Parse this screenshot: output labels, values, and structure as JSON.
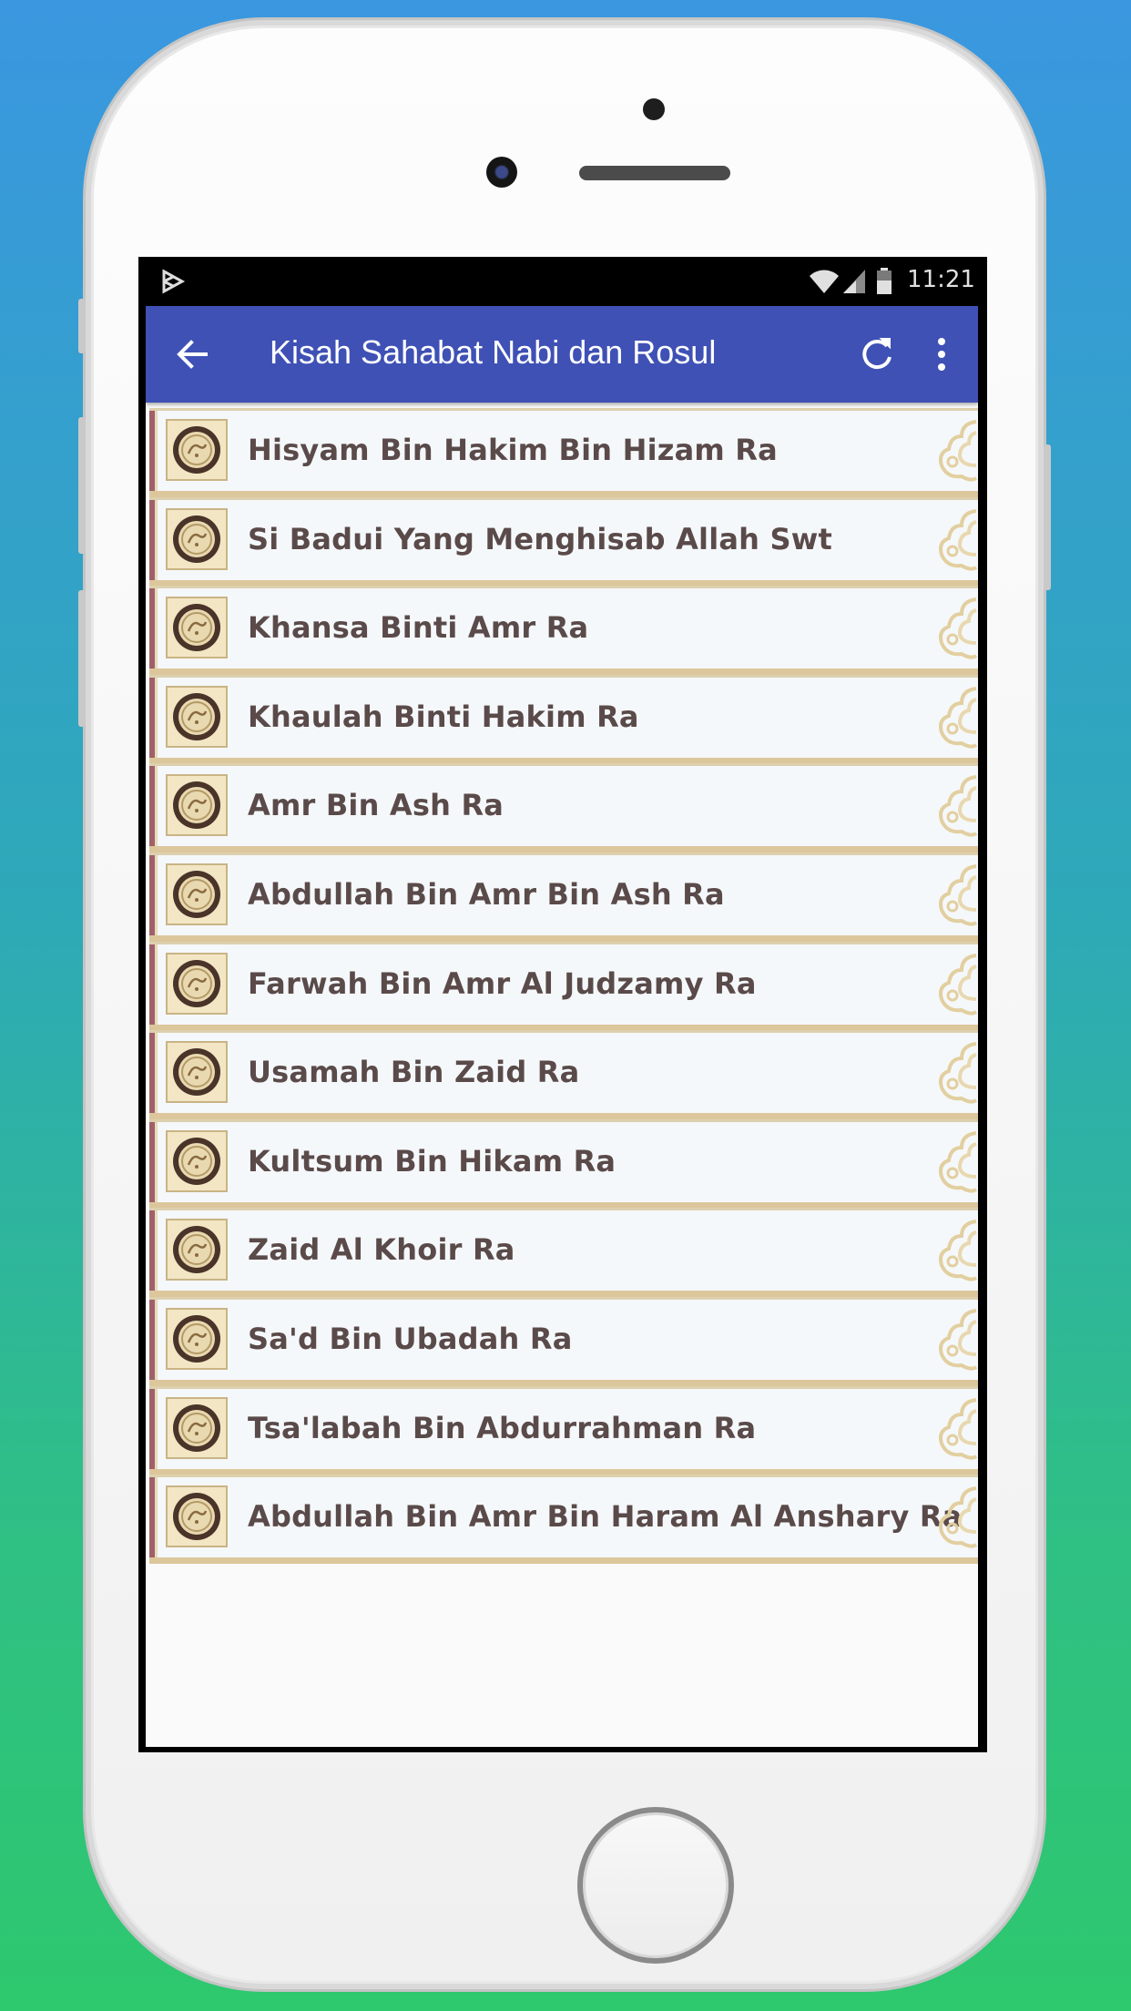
{
  "statusbar": {
    "time": "11:21",
    "icons": [
      "play-store-notification-icon",
      "wifi-icon",
      "signal-icon",
      "battery-icon"
    ]
  },
  "toolbar": {
    "title": "Kisah Sahabat Nabi dan Rosul",
    "back_icon": "arrow-back-icon",
    "refresh_icon": "refresh-icon",
    "more_icon": "more-vertical-icon",
    "color": "#3f51b5"
  },
  "list": {
    "items": [
      {
        "label": "Hisyam Bin Hakim Bin Hizam Ra"
      },
      {
        "label": "Si Badui Yang Menghisab Allah Swt"
      },
      {
        "label": "Khansa Binti Amr Ra"
      },
      {
        "label": "Khaulah Binti Hakim Ra"
      },
      {
        "label": "Amr Bin Ash Ra"
      },
      {
        "label": "Abdullah Bin Amr Bin Ash Ra"
      },
      {
        "label": "Farwah Bin Amr Al Judzamy Ra"
      },
      {
        "label": "Usamah Bin Zaid Ra"
      },
      {
        "label": "Kultsum Bin Hikam Ra"
      },
      {
        "label": "Zaid Al Khoir Ra"
      },
      {
        "label": "Sa'd Bin Ubadah Ra"
      },
      {
        "label": "Tsa'labah Bin Abdurrahman Ra"
      },
      {
        "label": "Abdullah Bin Amr Bin Haram Al Anshary Ra"
      }
    ]
  }
}
